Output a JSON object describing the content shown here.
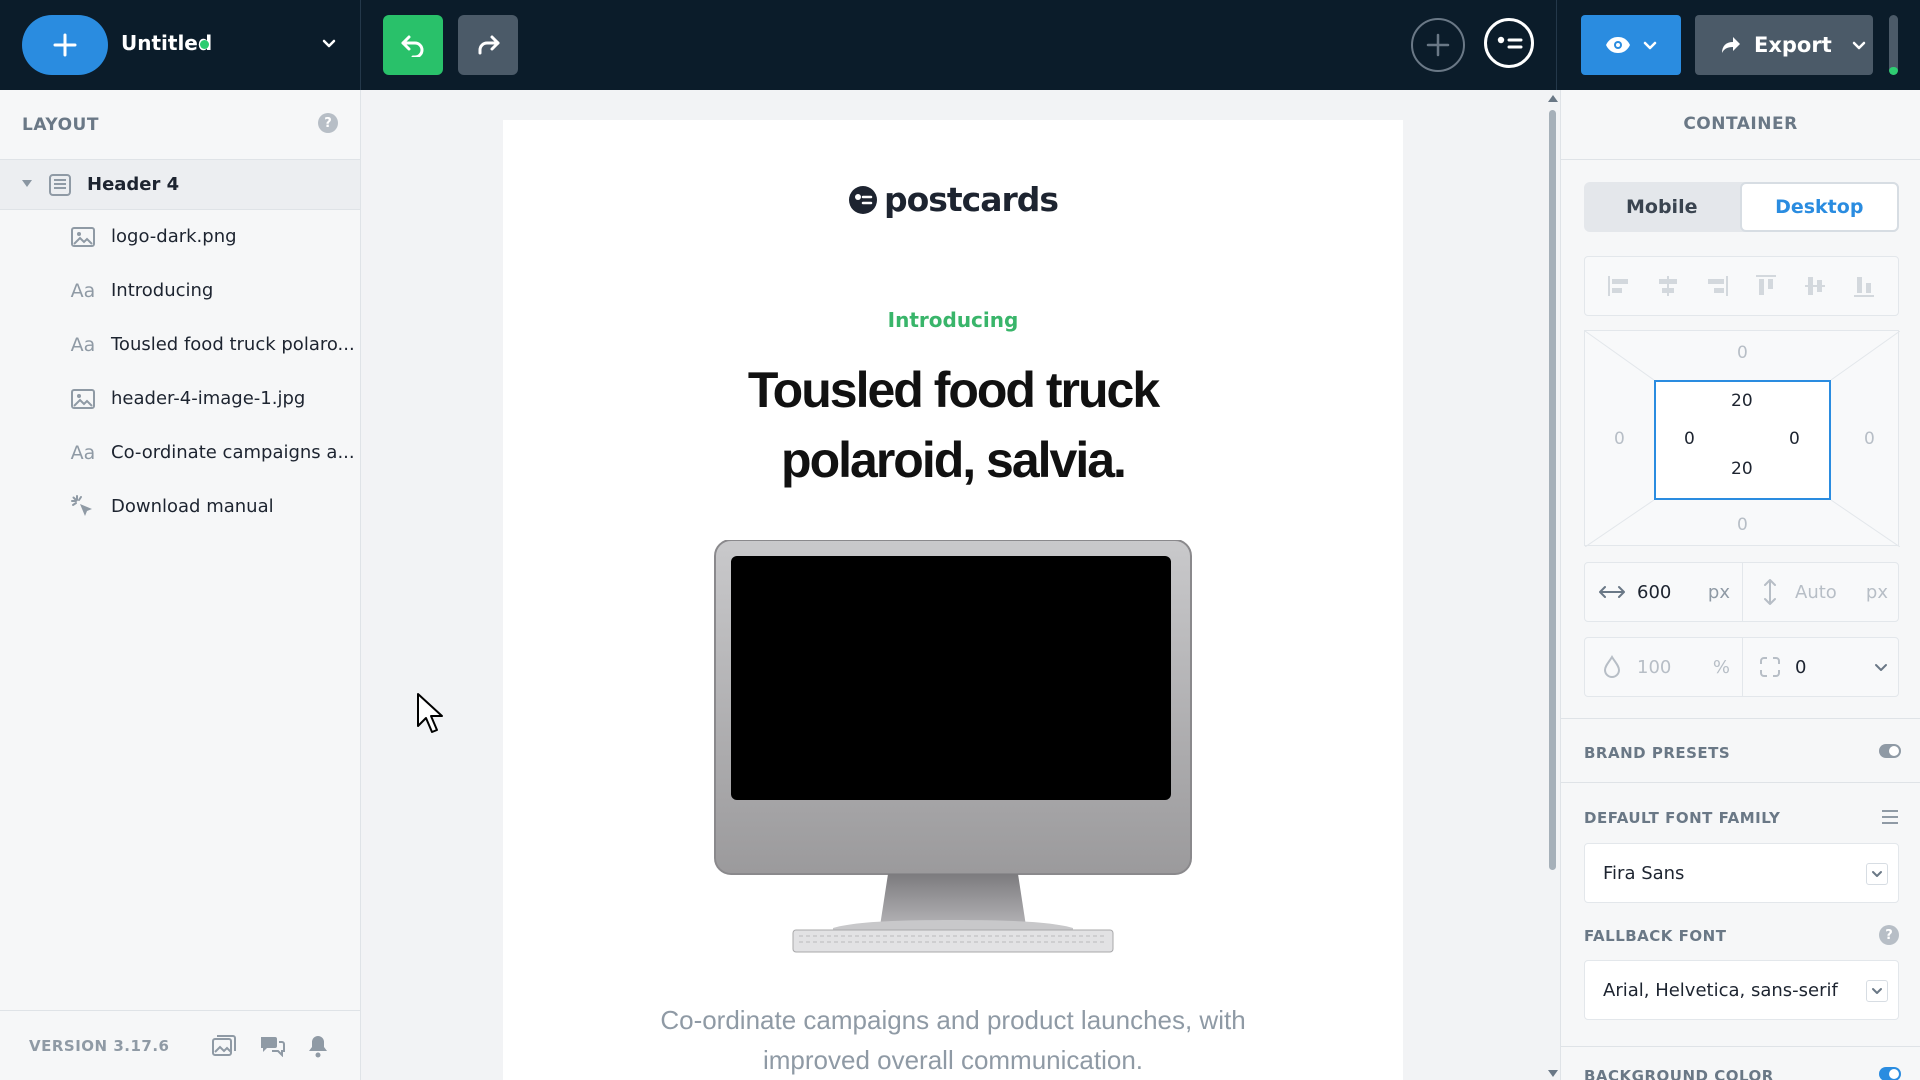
{
  "topbar": {
    "doc_title": "Untitled",
    "status_color": "#2ecc71",
    "export_label": "Export",
    "export_progress": 0.13
  },
  "layout_panel": {
    "title": "LAYOUT",
    "help": "?",
    "root": {
      "label": "Header 4",
      "icon": "section-icon"
    },
    "items": [
      {
        "label": "logo-dark.png",
        "icon": "image-icon"
      },
      {
        "label": "Introducing",
        "icon": "text-icon"
      },
      {
        "label": "Tousled food truck polaro...",
        "icon": "text-icon"
      },
      {
        "label": "header-4-image-1.jpg",
        "icon": "image-icon"
      },
      {
        "label": "Co-ordinate campaigns a...",
        "icon": "text-icon"
      },
      {
        "label": "Download manual",
        "icon": "click-icon"
      }
    ],
    "version": "VERSION 3.17.6"
  },
  "email": {
    "logo_text": "postcards",
    "intro": "Introducing",
    "headline": "Tousled food truck polaroid, salvia.",
    "body": "Co-ordinate campaigns and product launches, with improved overall communication."
  },
  "container_panel": {
    "title": "CONTAINER",
    "device_mobile": "Mobile",
    "device_desktop": "Desktop",
    "margin_top": "0",
    "margin_bottom": "0",
    "margin_left": "0",
    "margin_right": "0",
    "padding_top": "20",
    "padding_bottom": "20",
    "padding_left": "0",
    "padding_right": "0",
    "width_value": "600",
    "width_unit": "px",
    "height_value": "Auto",
    "height_unit": "px",
    "opacity_value": "100",
    "opacity_unit": "%",
    "radius_value": "0",
    "brand_presets_label": "BRAND PRESETS",
    "default_font_label": "DEFAULT FONT FAMILY",
    "default_font_value": "Fira Sans",
    "fallback_font_label": "FALLBACK FONT",
    "fallback_font_value": "Arial, Helvetica, sans-serif",
    "help": "?",
    "background_color_label": "BACKGROUND COLOR"
  },
  "colors": {
    "accent": "#2a8ce0",
    "success": "#29c16a",
    "topbar": "#0b1c2a",
    "intro_green": "#39b56a"
  }
}
